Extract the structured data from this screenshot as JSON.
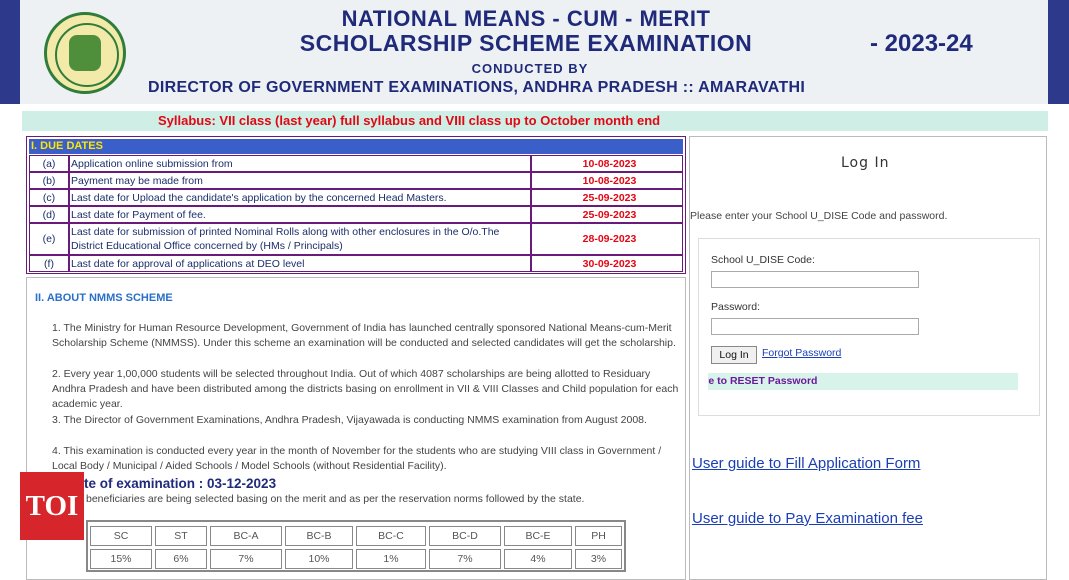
{
  "header": {
    "title_line1": "NATIONAL MEANS - CUM - MERIT",
    "title_line2": "SCHOLARSHIP SCHEME EXAMINATION",
    "year": "- 2023-24",
    "conducted_by": "CONDUCTED BY",
    "director": "DIRECTOR OF GOVERNMENT EXAMINATIONS, ANDHRA PRADESH :: AMARAVATHI",
    "emblem_icon": "andhra-pradesh-emblem"
  },
  "syllabus": "Syllabus: VII class (last year) full syllabus and VIII class up to October month end",
  "due_dates": {
    "heading": "I. DUE DATES",
    "rows": [
      {
        "sn": "(a)",
        "desc": "Application online submission from",
        "date": "10-08-2023"
      },
      {
        "sn": "(b)",
        "desc": "Payment may be made from",
        "date": "10-08-2023"
      },
      {
        "sn": "(c)",
        "desc": "Last date for Upload the candidate's application by the concerned Head Masters.",
        "date": "25-09-2023"
      },
      {
        "sn": "(d)",
        "desc": "Last date for Payment of fee.",
        "date": "25-09-2023"
      },
      {
        "sn": "(e)",
        "desc": "Last date for submission of printed Nominal Rolls along with other enclosures in the O/o.The District Educational Office concerned by (HMs / Principals)",
        "date": "28-09-2023"
      },
      {
        "sn": "(f)",
        "desc": "Last date for approval of applications at DEO level",
        "date": "30-09-2023"
      }
    ]
  },
  "about": {
    "heading": "II. ABOUT NMMS SCHEME",
    "points": [
      "1. The Ministry for Human Resource Development, Government of India has launched centrally sponsored National Means-cum-Merit Scholarship Scheme (NMMSS). Under this scheme an examination will be conducted and selected candidates will get the scholarship.",
      "2. Every year 1,00,000 students will be selected throughout India. Out of which 4087 scholarships are being allotted to Residuary Andhra Pradesh and have been distributed among the districts basing on enrollment in VII & VIII Classes and Child population for each academic year.",
      "3. The Director of Government Examinations, Andhra Pradesh, Vijayawada is conducting NMMS examination from August 2008.",
      "4. This examination is conducted every year in the month of November for the students who are studying VIII class in Government / Local Body / Municipal / Aided Schools / Model Schools (without Residential Facility)."
    ],
    "exam_date": "te of examination : 03-12-2023",
    "beneficiaries": "beneficiaries are being selected basing on the merit and as per the reservation norms followed by the state.",
    "reservation": {
      "headers": [
        "SC",
        "ST",
        "BC-A",
        "BC-B",
        "BC-C",
        "BC-D",
        "BC-E",
        "PH"
      ],
      "values": [
        "15%",
        "6%",
        "7%",
        "10%",
        "1%",
        "7%",
        "4%",
        "3%"
      ]
    }
  },
  "watermark": "TOI",
  "login": {
    "title": "Log In",
    "instructions": "Please enter your School U_DISE Code and password.",
    "udise_label": "School U_DISE Code:",
    "udise_value": "",
    "password_label": "Password:",
    "password_value": "",
    "button": "Log In",
    "forgot": "Forgot Password",
    "marquee": "Click here to RESET Password"
  },
  "guides": {
    "application": "User guide to Fill Application Form",
    "fee": "User guide to Pay Examination fee"
  }
}
